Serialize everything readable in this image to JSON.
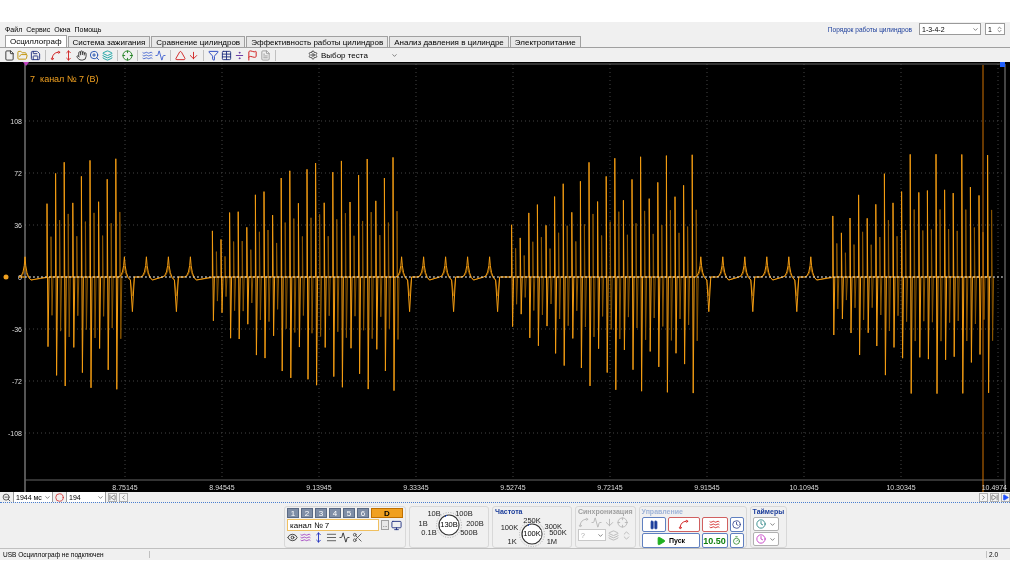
{
  "menu": [
    "Файл",
    "Сервис",
    "Окна",
    "Помощь"
  ],
  "cylinder_order": {
    "label": "Порядок работы цилиндров",
    "value": "1-3-4-2",
    "spin": "1"
  },
  "tabs": [
    {
      "label": "Осциллограф",
      "selected": true
    },
    {
      "label": "Система зажигания",
      "selected": false
    },
    {
      "label": "Сравнение цилиндров",
      "selected": false
    },
    {
      "label": "Эффективность работы цилиндров",
      "selected": false
    },
    {
      "label": "Анализ давления в цилиндре",
      "selected": false
    },
    {
      "label": "Электропитание",
      "selected": false
    }
  ],
  "toolbar": {
    "test_select": "Выбор теста"
  },
  "plot": {
    "channel_label": "7  канал № 7 (В)",
    "y_ticks": [
      "108",
      "72",
      "36",
      "0",
      "-36",
      "-72",
      "-108"
    ],
    "x_ticks": [
      "8.75145",
      "8.94545",
      "9.13945",
      "9.33345",
      "9.52745",
      "9.72145",
      "9.91545",
      "10.10945",
      "10.30345",
      "10.4974"
    ]
  },
  "timeline": {
    "span": "1944 мс",
    "count": "194"
  },
  "channel_panel": {
    "buttons": [
      {
        "label": "1",
        "selected": false
      },
      {
        "label": "2",
        "selected": false
      },
      {
        "label": "3",
        "selected": false
      },
      {
        "label": "4",
        "selected": false
      },
      {
        "label": "5",
        "selected": false
      },
      {
        "label": "6",
        "selected": false
      },
      {
        "label": "D",
        "selected": true
      }
    ],
    "channel": "канал № 7",
    "more": "...",
    "knob": {
      "value": "130В",
      "labels": [
        "10В",
        "100В",
        "1В",
        "200В",
        "0.1В",
        "500В"
      ]
    }
  },
  "frequency": {
    "title": "Частота",
    "knob": {
      "value": "100K",
      "labels": [
        "250K",
        "100K",
        "300K",
        "500K",
        "1K",
        "1M"
      ]
    }
  },
  "sync": {
    "title": "Синхронизация",
    "disabled": true,
    "select": "?"
  },
  "control": {
    "title": "Управление",
    "start": "Пуск",
    "time": "10.50"
  },
  "timers": {
    "title": "Таймеры"
  },
  "status_bar": {
    "message": "USB Осциллограф не подключен",
    "version": "2.0"
  }
}
